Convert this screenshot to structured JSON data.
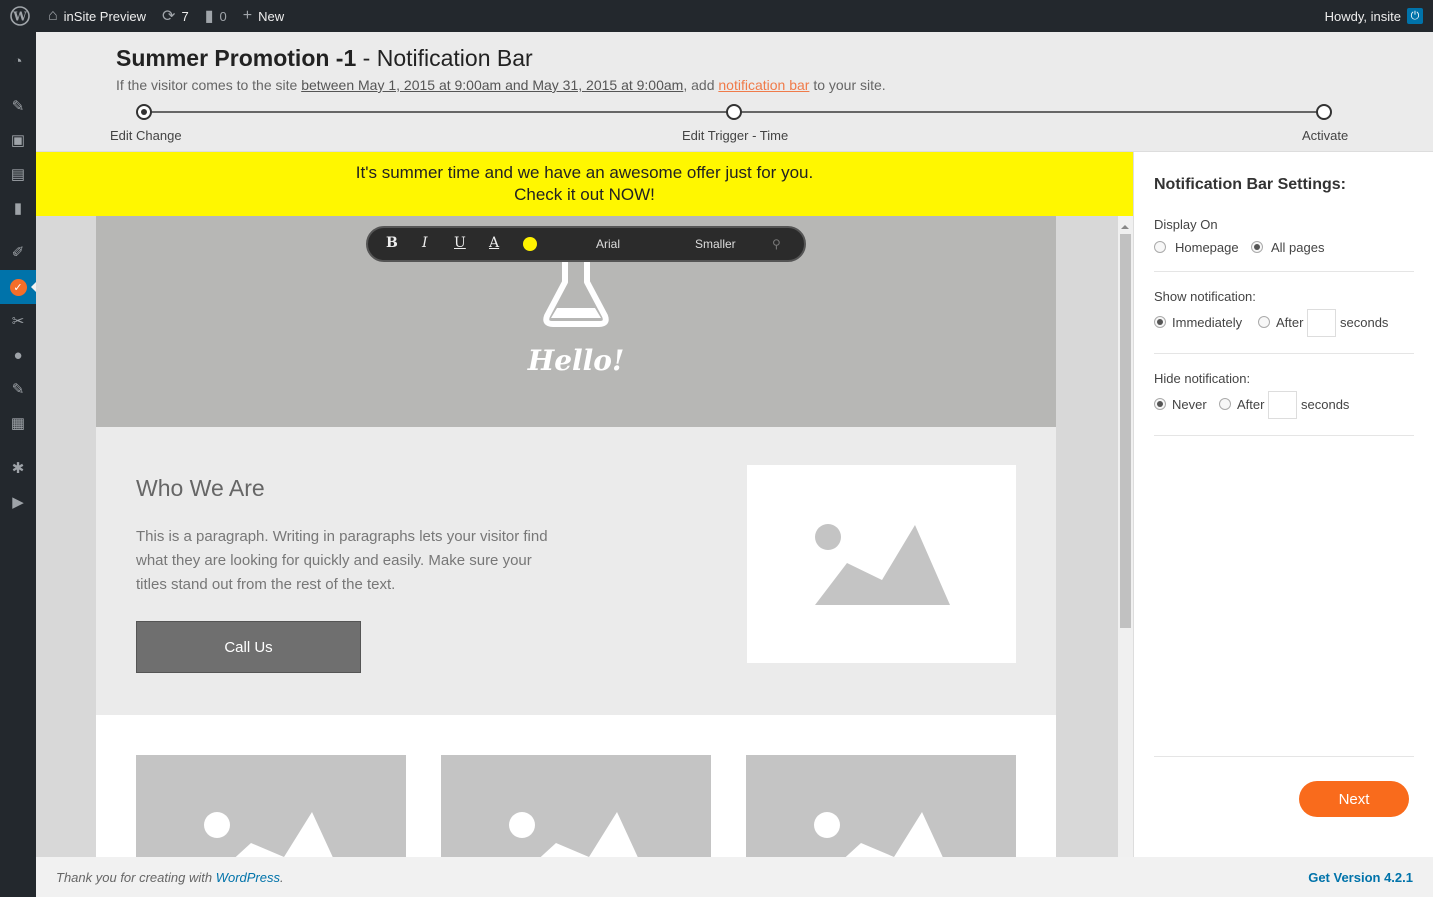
{
  "adminbar": {
    "site_name": "inSite Preview",
    "updates_count": "7",
    "comments_count": "0",
    "new_label": "New",
    "howdy": "Howdy, insite"
  },
  "sidebar": {
    "items": [
      "dashboard-icon",
      "pin-icon",
      "media-icon",
      "pages-icon",
      "comments-icon",
      "appearance-icon",
      "insite-icon",
      "plugins-icon",
      "users-icon",
      "tools-icon",
      "settings-import-icon",
      "gear-icon",
      "play-icon"
    ]
  },
  "header": {
    "title_bold": "Summer Promotion -1",
    "title_rest": " - Notification Bar",
    "sub_pre": "If the visitor comes to the site ",
    "sub_range": "between May 1, 2015 at 9:00am and May 31, 2015 at 9:00am",
    "sub_mid": ", add ",
    "sub_link": "notification bar",
    "sub_post": " to your site.",
    "steps": [
      "Edit Change",
      "Edit Trigger - Time",
      "Activate"
    ]
  },
  "notification": {
    "line1": "It's summer time and we have an awesome offer just for you.",
    "line2": "Check it out NOW!",
    "color": "#fff700"
  },
  "toolbar": {
    "bold": "B",
    "italic": "I",
    "underline": "U",
    "font_color": "A",
    "font": "Arial",
    "size": "Smaller"
  },
  "page": {
    "hero_text": "Hello!",
    "who_title": "Who We Are",
    "who_para": "This is a paragraph. Writing in paragraphs lets your visitor find what they are looking for quickly and easily. Make sure your titles stand out from the rest of the text.",
    "call_button": "Call Us"
  },
  "settings": {
    "title": "Notification Bar Settings:",
    "display_on": {
      "label": "Display On",
      "options": [
        "Homepage",
        "All pages"
      ],
      "selected": "All pages"
    },
    "show": {
      "label": "Show notification:",
      "opt1": "Immediately",
      "opt2": "After",
      "unit": "seconds",
      "selected": "Immediately"
    },
    "hide": {
      "label": "Hide notification:",
      "opt1": "Never",
      "opt2": "After",
      "unit": "seconds",
      "selected": "Never"
    },
    "next_label": "Next",
    "accent": "#f96b1c"
  },
  "footer": {
    "thanks_pre": "Thank you for creating with ",
    "thanks_link": "WordPress",
    "thanks_post": ".",
    "version": "Get Version 4.2.1"
  }
}
